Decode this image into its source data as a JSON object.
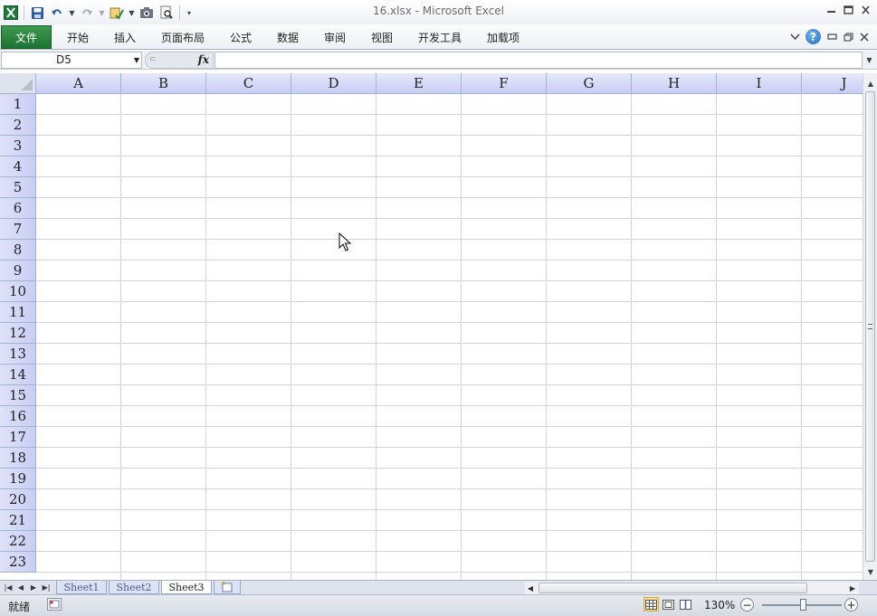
{
  "window": {
    "title": "16.xlsx  -  Microsoft Excel"
  },
  "quick_access": {
    "icons": [
      "excel-logo-icon",
      "save-icon",
      "undo-icon",
      "redo-icon",
      "spelling-check-icon",
      "camera-icon",
      "print-preview-icon",
      "customize-qat-icon"
    ]
  },
  "ribbon": {
    "file_tab": "文件",
    "tabs": [
      "开始",
      "插入",
      "页面布局",
      "公式",
      "数据",
      "审阅",
      "视图",
      "开发工具",
      "加载项"
    ]
  },
  "formula_bar": {
    "name_box": "D5",
    "fx_label": "fx",
    "formula": ""
  },
  "sheet": {
    "columns": [
      "A",
      "B",
      "C",
      "D",
      "E",
      "F",
      "G",
      "H",
      "I",
      "J"
    ],
    "rows": [
      "1",
      "2",
      "3",
      "4",
      "5",
      "6",
      "7",
      "8",
      "9",
      "10",
      "11",
      "12",
      "13",
      "14",
      "15",
      "16",
      "17",
      "18",
      "19",
      "20",
      "21",
      "22",
      "23"
    ]
  },
  "sheet_tabs": {
    "tabs": [
      "Sheet1",
      "Sheet2",
      "Sheet3"
    ],
    "active": "Sheet3"
  },
  "status_bar": {
    "status_text": "就绪",
    "zoom_level": "130%"
  },
  "colors": {
    "file_tab": "#2a8240",
    "header_fill": "#c9cdf4",
    "gridline": "#d4d4d4"
  }
}
